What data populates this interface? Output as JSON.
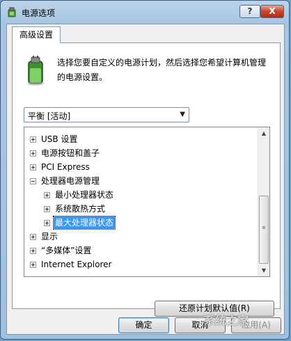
{
  "window": {
    "title": "电源选项",
    "help_label": "?",
    "close_label": "X"
  },
  "tab": {
    "label": "高级设置"
  },
  "description": "选择您要自定义的电源计划，然后选择您希望计算机管理的电源设置。",
  "plan_select": {
    "value": "平衡 [活动]",
    "arrow": "▼"
  },
  "tree": {
    "items": [
      {
        "label": "USB 设置",
        "expanded": false,
        "level": 0
      },
      {
        "label": "电源按钮和盖子",
        "expanded": false,
        "level": 0
      },
      {
        "label": "PCI Express",
        "expanded": false,
        "level": 0
      },
      {
        "label": "处理器电源管理",
        "expanded": true,
        "level": 0
      },
      {
        "label": "最小处理器状态",
        "expanded": false,
        "level": 1
      },
      {
        "label": "系统散热方式",
        "expanded": false,
        "level": 1
      },
      {
        "label": "最大处理器状态",
        "expanded": false,
        "level": 1,
        "selected": true
      },
      {
        "label": "显示",
        "expanded": false,
        "level": 0
      },
      {
        "label": "“多媒体”设置",
        "expanded": false,
        "level": 0
      },
      {
        "label": "Internet Explorer",
        "expanded": false,
        "level": 0
      }
    ],
    "scroll_up": "▲",
    "scroll_down": "▼"
  },
  "buttons": {
    "restore": "还原计划默认值(R)",
    "ok": "确定",
    "cancel": "取消",
    "apply": "应用(A)"
  },
  "watermark": "系统之家",
  "colors": {
    "selection": "#3399ff",
    "title_bar": "#a8c6e2",
    "close_button": "#c8432e"
  }
}
